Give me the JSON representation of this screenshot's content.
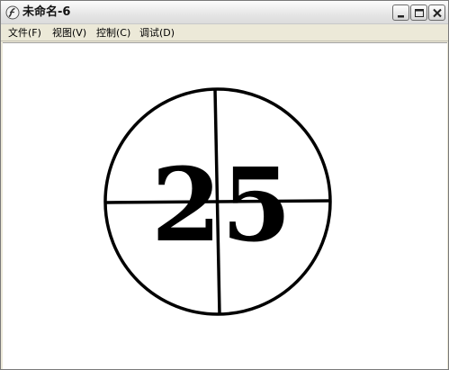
{
  "window": {
    "title": "未命名-6",
    "icon": "flash-player-icon",
    "buttons": {
      "minimize": "minimize-icon",
      "maximize": "maximize-icon",
      "close": "close-icon"
    }
  },
  "menu": {
    "items": [
      {
        "label": "文件(F)"
      },
      {
        "label": "视图(V)"
      },
      {
        "label": "控制(C)"
      },
      {
        "label": "调试(D)"
      }
    ]
  },
  "stage": {
    "countdown_value": "25",
    "colors": {
      "ink": "#000000",
      "background": "#ffffff",
      "close_button": "#c8c8c8"
    }
  }
}
